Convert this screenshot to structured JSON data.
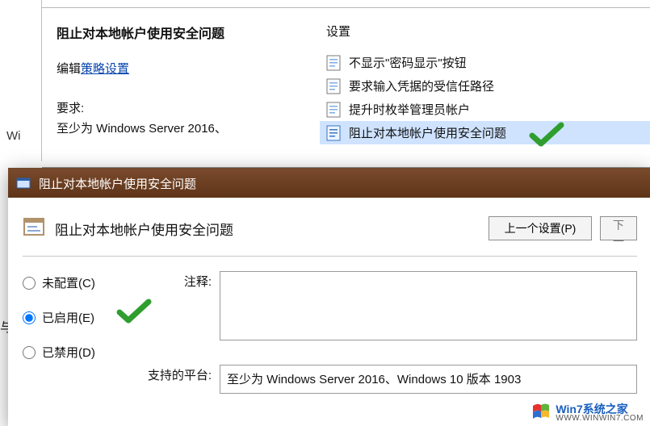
{
  "bg": {
    "left_tree_fragment": "Wi",
    "heading": "阻止对本地帐户使用安全问题",
    "edit_prefix": "编辑",
    "edit_link": "策略设置",
    "req_label": "要求:",
    "req_text": "至少为 Windows Server 2016、",
    "settings_header": "设置",
    "items": [
      "不显示\"密码显示\"按钮",
      "要求输入凭据的受信任路径",
      "提升时枚举管理员帐户",
      "阻止对本地帐户使用安全问题"
    ]
  },
  "dialog": {
    "title": "阻止对本地帐户使用安全问题",
    "heading": "阻止对本地帐户使用安全问题",
    "prev_btn": "上一个设置(P)",
    "next_btn": "下一",
    "radios": {
      "not_configured": "未配置(C)",
      "enabled": "已启用(E)",
      "disabled": "已禁用(D)"
    },
    "comment_label": "注释:",
    "comment_value": "",
    "platform_label": "支持的平台:",
    "platform_value": "至少为 Windows Server 2016、Windows 10 版本 1903"
  },
  "left_fragment": "与",
  "watermark": {
    "main": "Win7系统之家",
    "sub": "WWW.WINWIN7.COM"
  }
}
